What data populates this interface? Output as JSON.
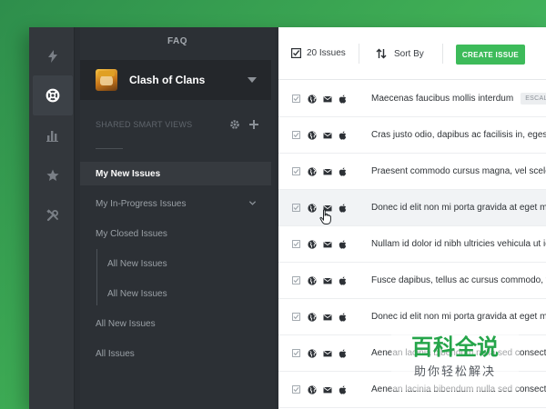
{
  "rail": {
    "items": [
      {
        "icon": "lightning-icon",
        "active": false
      },
      {
        "icon": "lifebuoy-icon",
        "active": true
      },
      {
        "icon": "bar-chart-icon",
        "active": false
      },
      {
        "icon": "star-icon",
        "active": false
      },
      {
        "icon": "tools-icon",
        "active": false
      }
    ]
  },
  "sidebar": {
    "title": "FAQ",
    "project": "Clash of Clans",
    "smart_views_label": "SHARED SMART VIEWS",
    "nav": [
      {
        "label": "My New Issues",
        "active": true
      },
      {
        "label": "My In-Progress Issues"
      },
      {
        "label": "My Closed Issues"
      },
      {
        "label": "All New Issues"
      },
      {
        "label": "All New Issues"
      },
      {
        "label": "All New Issues"
      },
      {
        "label": "All Issues"
      }
    ]
  },
  "toolbar": {
    "issues_count": "20 Issues",
    "sort_label": "Sort By",
    "create_label": "CREATE ISSUE"
  },
  "issues": [
    {
      "title": "Maecenas faucibus mollis interdum",
      "badge": "ESCALATED"
    },
    {
      "title": "Cras justo odio, dapibus ac facilisis in, egestas eget quam"
    },
    {
      "title": "Praesent commodo cursus magna, vel scelerisque nisl"
    },
    {
      "title": "Donec id elit non mi porta gravida at eget metus"
    },
    {
      "title": "Nullam id dolor id nibh ultricies vehicula ut id elit"
    },
    {
      "title": "Fusce dapibus, tellus ac cursus commodo, tortor mauris"
    },
    {
      "title": "Donec id elit non mi porta gravida at eget metus"
    },
    {
      "title": "Aenean lacinia bibendum nulla sed consectetur"
    },
    {
      "title": "Aenean lacinia bibendum nulla sed consectetur"
    }
  ],
  "watermark": {
    "main": "百科全说",
    "sub": "助你轻松解决"
  },
  "colors": {
    "accent": "#3dbb5a",
    "background": "#3fae55",
    "frame": "#2a2e33"
  }
}
